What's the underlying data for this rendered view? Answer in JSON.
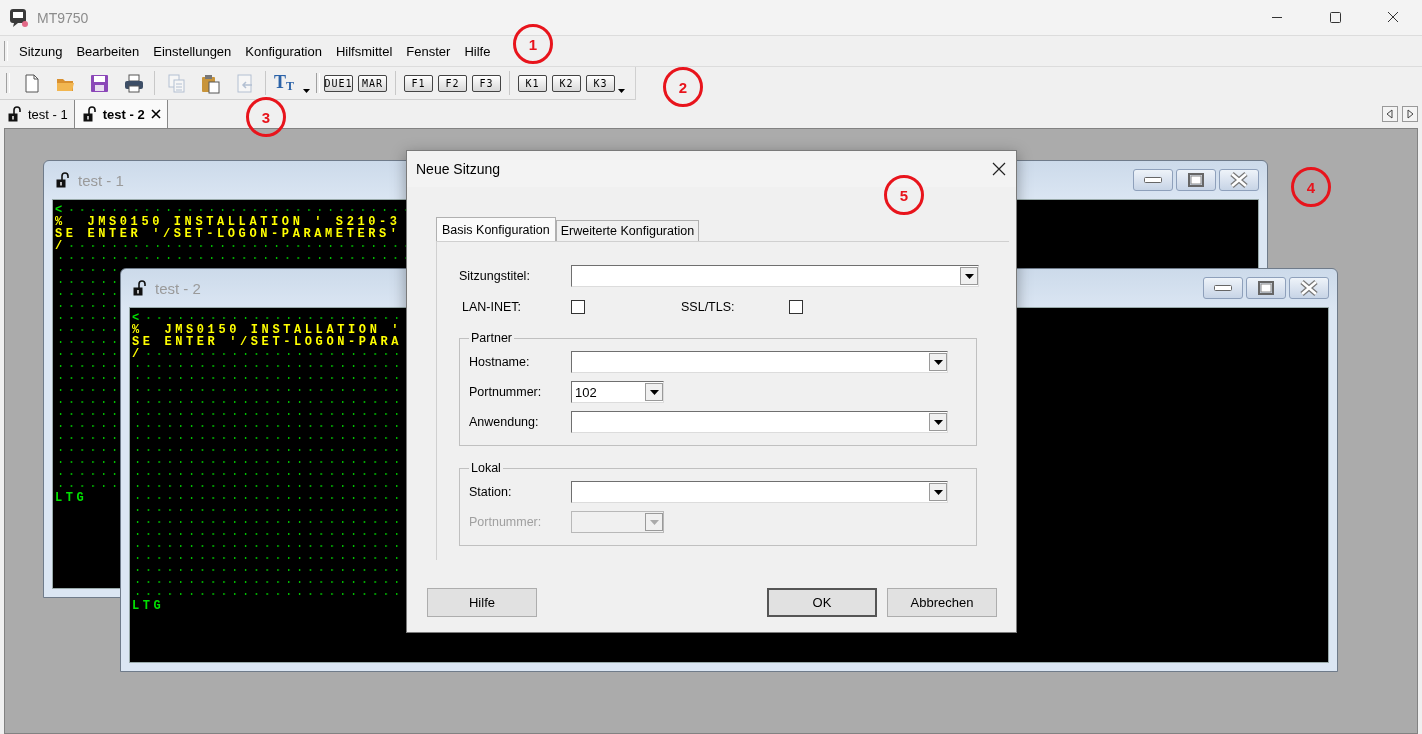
{
  "app": {
    "title": "MT9750"
  },
  "menu": [
    "Sitzung",
    "Bearbeiten",
    "Einstellungen",
    "Konfiguration",
    "Hilfsmittel",
    "Fenster",
    "Hilfe"
  ],
  "toolbar": {
    "tool_groups": [
      {
        "tools": [
          {
            "kind": "new",
            "disabled": false
          },
          {
            "kind": "open",
            "disabled": false
          },
          {
            "kind": "save",
            "disabled": false
          },
          {
            "kind": "print",
            "disabled": false
          }
        ]
      },
      {
        "tools": [
          {
            "kind": "copy",
            "disabled": true
          },
          {
            "kind": "paste",
            "disabled": false
          },
          {
            "kind": "paste-special",
            "disabled": true
          }
        ]
      },
      {
        "tools": [
          {
            "kind": "font",
            "disabled": false,
            "glyphs": [
              "T",
              "T"
            ]
          }
        ]
      }
    ],
    "key_groups": [
      {
        "keys": [
          "DUE1",
          "MAR"
        ]
      },
      {
        "keys": [
          "F1",
          "F2",
          "F3"
        ]
      },
      {
        "keys": [
          "K1",
          "K2",
          "K3"
        ]
      }
    ]
  },
  "session_tabs": [
    {
      "label": "test - 1",
      "selected": false
    },
    {
      "label": "test - 2",
      "selected": true
    }
  ],
  "session_windows": [
    {
      "title": "test - 1",
      "lines": [
        {
          "kind": "cursor",
          "text": "<"
        },
        {
          "kind": "output",
          "text": "%  JMS0150 INSTALLATION ' S210-3"
        },
        {
          "kind": "output",
          "text": "SE ENTER '/SET-LOGON-PARAMETERS'"
        },
        {
          "kind": "output",
          "text": "/"
        }
      ],
      "status": "LTG"
    },
    {
      "title": "test - 2",
      "lines": [
        {
          "kind": "cursor",
          "text": "<"
        },
        {
          "kind": "output",
          "text": "%  JMS0150 INSTALLATION '"
        },
        {
          "kind": "output",
          "text": "SE ENTER '/SET-LOGON-PARA"
        },
        {
          "kind": "output",
          "text": "/"
        }
      ],
      "status": "LTG"
    }
  ],
  "dialog": {
    "title": "Neue Sitzung",
    "tabs": [
      {
        "label": "Basis Konfiguration",
        "selected": true
      },
      {
        "label": "Erweiterte Konfiguration",
        "selected": false
      }
    ],
    "session_title": {
      "label": "Sitzungstitel:"
    },
    "checkboxes": [
      {
        "label": "LAN-INET:",
        "checked": false
      },
      {
        "label": "SSL/TLS:",
        "checked": false
      }
    ],
    "groups": [
      {
        "title": "Partner",
        "fields": [
          {
            "label": "Hostname:",
            "kind": "wide",
            "disabled": false
          },
          {
            "label": "Portnummer:",
            "kind": "narrow",
            "value": "102",
            "disabled": false
          },
          {
            "label": "Anwendung:",
            "kind": "wide",
            "disabled": false
          }
        ]
      },
      {
        "title": "Lokal",
        "fields": [
          {
            "label": "Station:",
            "kind": "wide",
            "disabled": false
          },
          {
            "label": "Portnummer:",
            "kind": "narrow",
            "disabled": true
          }
        ]
      }
    ],
    "buttons": [
      {
        "label": "Hilfe",
        "default": false
      },
      {
        "label": "OK",
        "default": true
      },
      {
        "label": "Abbrechen",
        "default": false
      }
    ]
  },
  "annotations": [
    "1",
    "2",
    "3",
    "4",
    "5"
  ]
}
